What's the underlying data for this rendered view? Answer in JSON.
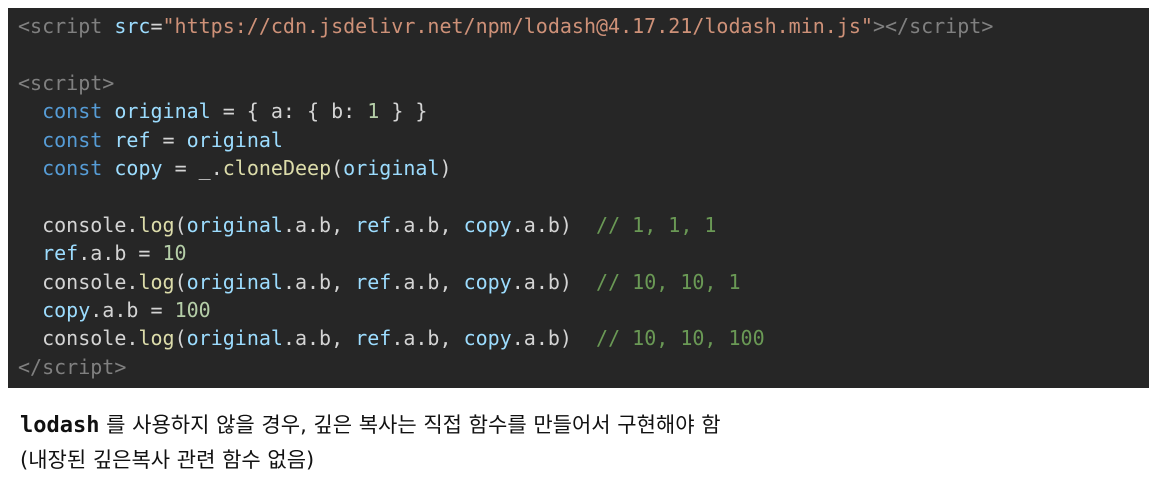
{
  "code": {
    "line1": {
      "open": "<",
      "tag": "script",
      "attr": "src",
      "eq": "=",
      "value": "\"https://cdn.jsdelivr.net/npm/lodash@4.17.21/lodash.min.js\"",
      "close": "></",
      "tag2": "script",
      "end": ">"
    },
    "line3": {
      "open": "<",
      "tag": "script",
      "end": ">"
    },
    "line4": {
      "indent": "  ",
      "kw": "const",
      "name": "original",
      "rest1": " = { a: { b: ",
      "num": "1",
      "rest2": " } }"
    },
    "line5": {
      "indent": "  ",
      "kw": "const",
      "name": "ref",
      "eq": " = ",
      "value": "original"
    },
    "line6": {
      "indent": "  ",
      "kw": "const",
      "name": "copy",
      "eq": " = _.",
      "fn": "cloneDeep",
      "open": "(",
      "arg": "original",
      "close": ")"
    },
    "line8": {
      "indent": "  ",
      "obj": "console",
      "dot": ".",
      "fn": "log",
      "open": "(",
      "a1": "original",
      "p1": ".a.b, ",
      "a2": "ref",
      "p2": ".a.b, ",
      "a3": "copy",
      "p3": ".a.b)",
      "gap": "  ",
      "comment": "// 1, 1, 1"
    },
    "line9": {
      "indent": "  ",
      "obj": "ref",
      "rest": ".a.b = ",
      "num": "10"
    },
    "line10": {
      "indent": "  ",
      "obj": "console",
      "dot": ".",
      "fn": "log",
      "open": "(",
      "a1": "original",
      "p1": ".a.b, ",
      "a2": "ref",
      "p2": ".a.b, ",
      "a3": "copy",
      "p3": ".a.b)",
      "gap": "  ",
      "comment": "// 10, 10, 1"
    },
    "line11": {
      "indent": "  ",
      "obj": "copy",
      "rest": ".a.b = ",
      "num": "100"
    },
    "line12": {
      "indent": "  ",
      "obj": "console",
      "dot": ".",
      "fn": "log",
      "open": "(",
      "a1": "original",
      "p1": ".a.b, ",
      "a2": "ref",
      "p2": ".a.b, ",
      "a3": "copy",
      "p3": ".a.b)",
      "gap": "  ",
      "comment": "// 10, 10, 100"
    },
    "line13": {
      "open": "</",
      "tag": "script",
      "end": ">"
    }
  },
  "caption": {
    "code_word": "lodash",
    "line1_rest": " 를 사용하지 않을 경우, 깊은 복사는 직접 함수를 만들어서 구현해야 함",
    "line2": "(내장된 깊은복사 관련 함수 없음)"
  },
  "colors": {
    "panel_bg": "#262626",
    "keyword": "#569cd6",
    "variable": "#9cdcfe",
    "string": "#ce9178",
    "number": "#b5cea8",
    "function": "#dcdcaa",
    "comment": "#6a9955",
    "tag": "#808080"
  }
}
